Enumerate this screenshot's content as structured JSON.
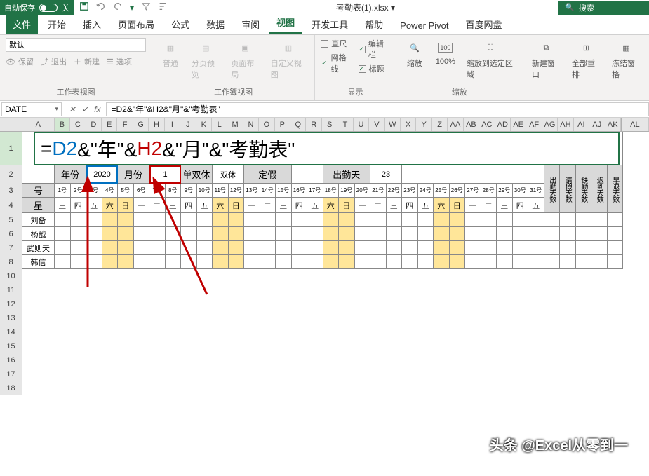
{
  "titlebar": {
    "autosave": "自动保存",
    "autosave_state": "关",
    "filename": "考勤表(1).xlsx ▾",
    "search_placeholder": "搜索"
  },
  "tabs": {
    "file": "文件",
    "home": "开始",
    "insert": "插入",
    "page_layout": "页面布局",
    "formulas": "公式",
    "data": "数据",
    "review": "审阅",
    "view": "视图",
    "developer": "开发工具",
    "help": "帮助",
    "powerpivot": "Power Pivot",
    "baidu": "百度网盘"
  },
  "ribbon": {
    "group_views": {
      "label": "工作表视图",
      "default": "默认",
      "keep": "保留",
      "exit": "退出",
      "new": "新建",
      "options": "选项"
    },
    "group_workbook": {
      "label": "工作簿视图",
      "normal": "普通",
      "page_break": "分页预览",
      "page_layout": "页面布局",
      "custom": "自定义视图"
    },
    "group_show": {
      "label": "显示",
      "ruler": "直尺",
      "gridlines": "网格线",
      "formula_bar": "编辑栏",
      "headings": "标题"
    },
    "group_zoom": {
      "label": "缩放",
      "zoom": "缩放",
      "hundred": "100%",
      "to_selection": "缩放到选定区域"
    },
    "group_window": {
      "new_window": "新建窗口",
      "arrange_all": "全部重排",
      "freeze": "冻结窗格"
    }
  },
  "formula_bar": {
    "name_box": "DATE",
    "formula": "=D2&\"年\"&H2&\"月\"&\"考勤表\""
  },
  "columns": [
    "A",
    "B",
    "C",
    "D",
    "E",
    "F",
    "G",
    "H",
    "I",
    "J",
    "K",
    "L",
    "M",
    "N",
    "O",
    "P",
    "Q",
    "R",
    "S",
    "T",
    "U",
    "V",
    "W",
    "X",
    "Y",
    "Z",
    "AA",
    "AB",
    "AC",
    "AD",
    "AE",
    "AF",
    "AG",
    "AH",
    "AI",
    "AJ",
    "AK"
  ],
  "extra_col": "AL",
  "row1_formula_parts": {
    "eq": "=",
    "d2": "D2",
    "amp1": "&\"年\"&",
    "h2": "H2",
    "amp2": "&\"月\"&\"考勤表\""
  },
  "row2": {
    "year_lbl": "年份",
    "year_val": "2020",
    "month_lbl": "月份",
    "month_val": "1",
    "rest_lbl": "单双休",
    "rest_val": "双休",
    "holiday_lbl": "定假",
    "attend_lbl": "出勤天",
    "attend_val": "23"
  },
  "stat_headers": [
    "出勤天数",
    "请假天数",
    "缺勤天数",
    "迟到天数",
    "早退天数"
  ],
  "row3_label": "号",
  "row3_days": [
    "1号",
    "2号",
    "3号",
    "4号",
    "5号",
    "6号",
    "7号",
    "8号",
    "9号",
    "10号",
    "11号",
    "12号",
    "13号",
    "14号",
    "15号",
    "16号",
    "17号",
    "18号",
    "19号",
    "20号",
    "21号",
    "22号",
    "23号",
    "24号",
    "25号",
    "26号",
    "27号",
    "28号",
    "29号",
    "30号",
    "31号"
  ],
  "row4_label": "星",
  "row4_days": [
    "三",
    "四",
    "五",
    "六",
    "日",
    "一",
    "二",
    "三",
    "四",
    "五",
    "六",
    "日",
    "一",
    "二",
    "三",
    "四",
    "五",
    "六",
    "日",
    "一",
    "二",
    "三",
    "四",
    "五",
    "六",
    "日",
    "一",
    "二",
    "三",
    "四",
    "五"
  ],
  "weekend_idx": [
    3,
    4,
    10,
    11,
    17,
    18,
    24,
    25
  ],
  "names": [
    "刘备",
    "杨戬",
    "武则天",
    "韩信"
  ],
  "watermark": "头条 @Excel从零到一"
}
